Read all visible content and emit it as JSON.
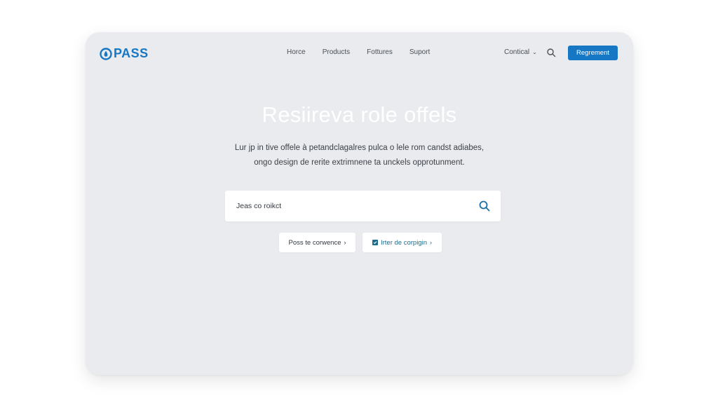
{
  "header": {
    "logo_text": "PASS",
    "nav": [
      {
        "label": "Horce"
      },
      {
        "label": "Products"
      },
      {
        "label": "Fottures"
      },
      {
        "label": "Suport"
      }
    ],
    "contact_label": "Contical",
    "cta_label": "Regrement"
  },
  "hero": {
    "title": "Resiireva role offels",
    "subtitle_line1": "Lur jp in tive offele à petandclagalres pulca o lele rom candst adiabes,",
    "subtitle_line2": "ongo design de rerite extrimnene ta unckels opprotunment."
  },
  "search": {
    "value": "Jeas co roikct"
  },
  "actions": [
    {
      "label": "Poss te corwence",
      "arrow": "›"
    },
    {
      "label": "Irter de corpigin",
      "arrow": "›"
    }
  ],
  "colors": {
    "accent": "#1677c5",
    "background": "#e9ebee"
  },
  "icons": {
    "logo": "drop-logo-icon",
    "contact": "chevron-down-icon",
    "search": "search-icon",
    "action_two": "checkbox-icon"
  }
}
